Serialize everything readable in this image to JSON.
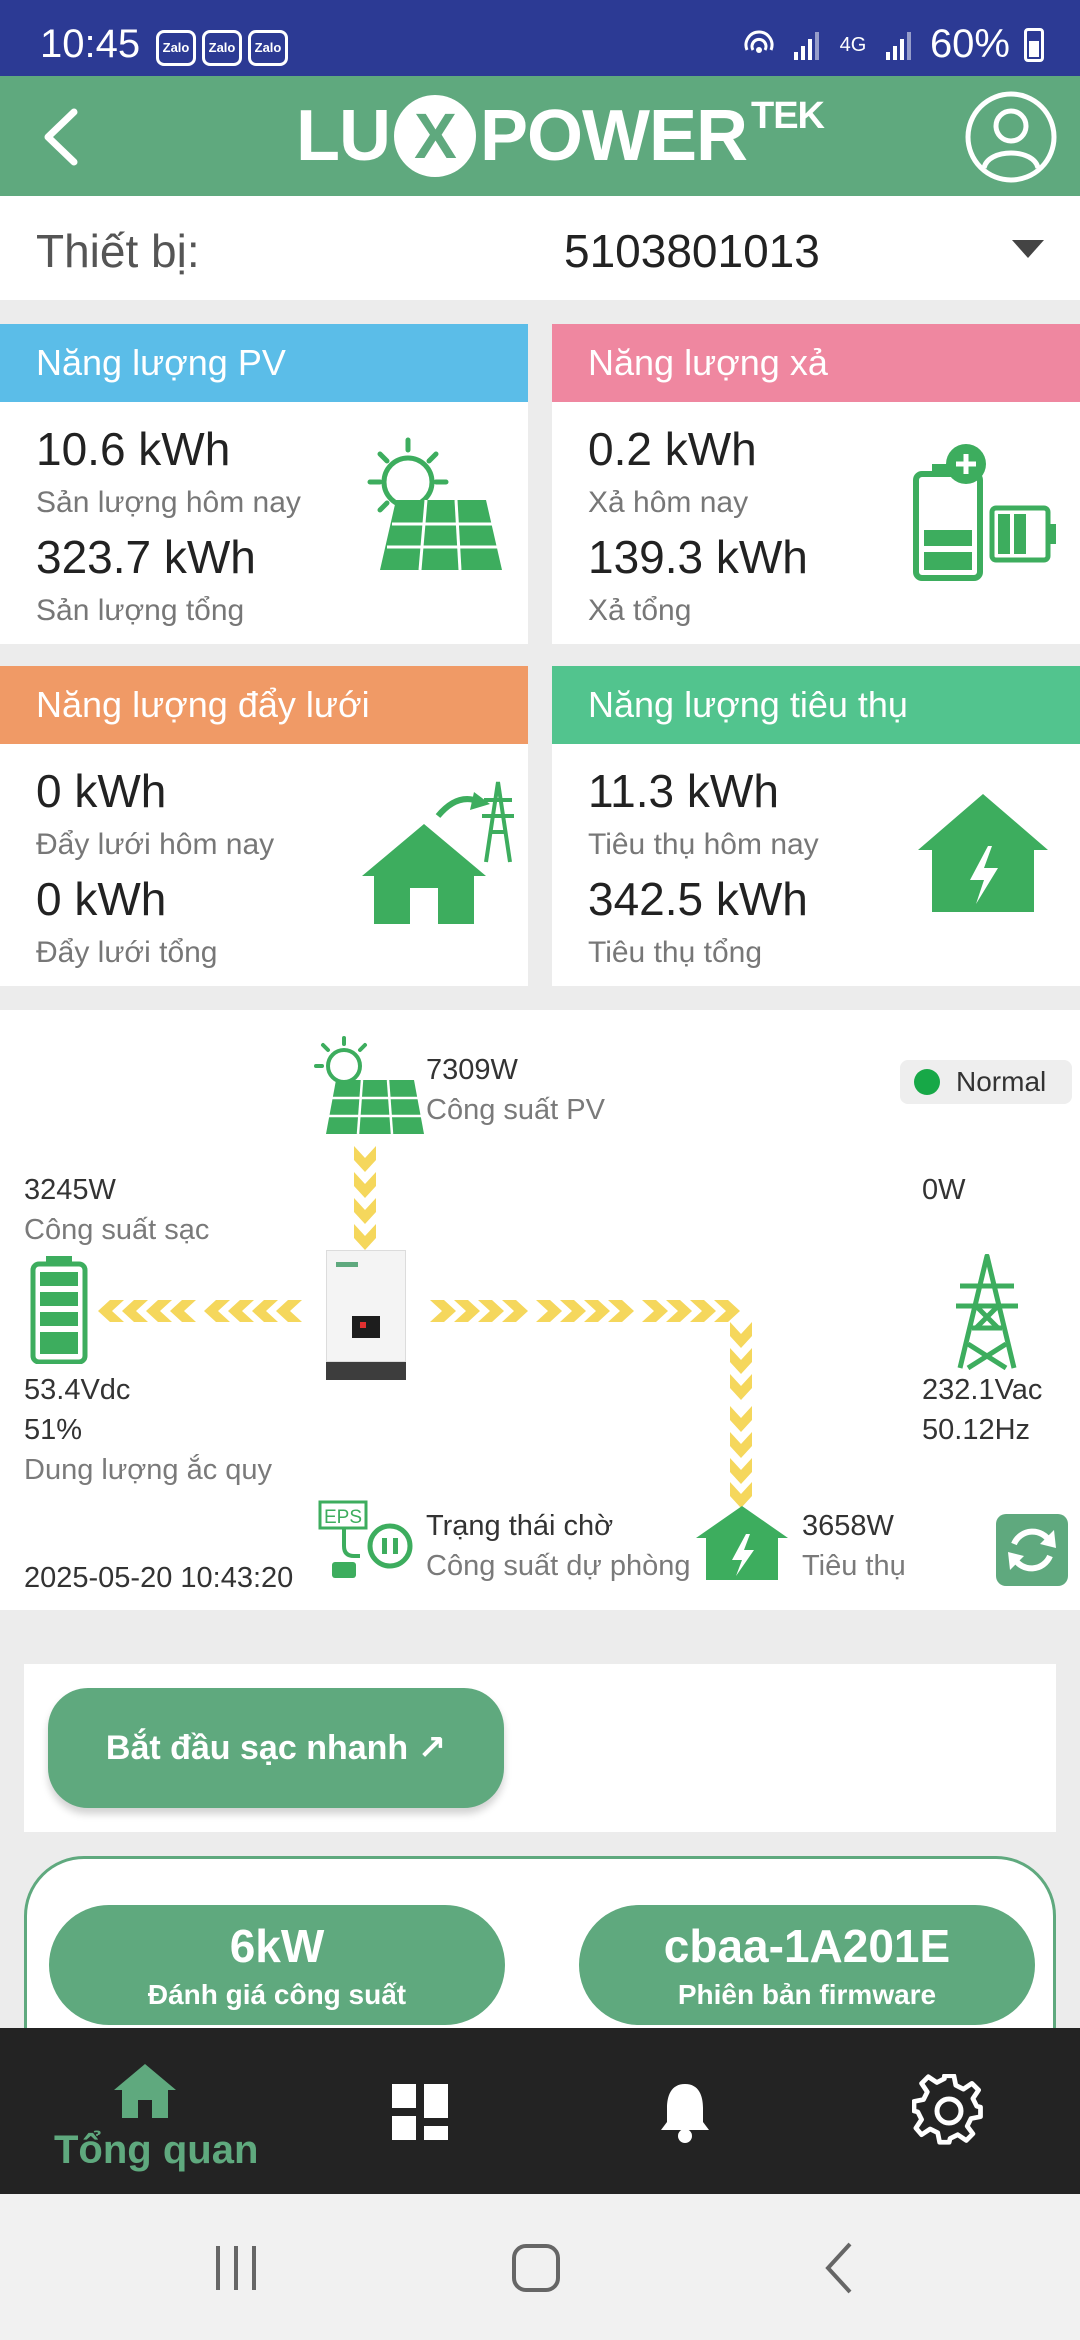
{
  "status_bar": {
    "time": "10:45",
    "notifications": [
      "Zalo",
      "Zalo",
      "Zalo"
    ],
    "network": "4G",
    "battery": "60%"
  },
  "app_bar": {
    "logo_left": "LU",
    "logo_x": "X",
    "logo_right": "POWER",
    "logo_sup": "TEK"
  },
  "device": {
    "label": "Thiết bị:",
    "value": "5103801013"
  },
  "cards": {
    "pv": {
      "title": "Năng lượng PV",
      "today_value": "10.6 kWh",
      "today_label": "Sản lượng hôm nay",
      "total_value": "323.7 kWh",
      "total_label": "Sản lượng tổng",
      "color": "#5bbde8"
    },
    "discharge": {
      "title": "Năng lượng xả",
      "today_value": "0.2 kWh",
      "today_label": "Xả hôm nay",
      "total_value": "139.3 kWh",
      "total_label": "Xả tổng",
      "color": "#ef87a0"
    },
    "grid": {
      "title": "Năng lượng đẩy lưới",
      "today_value": "0 kWh",
      "today_label": "Đẩy lưới hôm nay",
      "total_value": "0 kWh",
      "total_label": "Đẩy lưới tổng",
      "color": "#f09a66"
    },
    "consumption": {
      "title": "Năng lượng tiêu thụ",
      "today_value": "11.3 kWh",
      "today_label": "Tiêu thụ hôm nay",
      "total_value": "342.5 kWh",
      "total_label": "Tiêu thụ tổng",
      "color": "#52c48e"
    }
  },
  "flow": {
    "status": "Normal",
    "pv_power": "7309W",
    "pv_label": "Công suất PV",
    "charge_power": "3245W",
    "charge_label": "Công suất sạc",
    "battery_voltage": "53.4Vdc",
    "battery_soc": "51%",
    "battery_label": "Dung lượng ắc quy",
    "grid_power": "0W",
    "grid_voltage": "232.1Vac",
    "grid_freq": "50.12Hz",
    "eps_status": "Trạng thái chờ",
    "eps_label": "Công suất dự phòng",
    "eps_icon_text": "EPS",
    "load_power": "3658W",
    "load_label": "Tiêu thụ",
    "timestamp": "2025-05-20 10:43:20"
  },
  "fast_charge": {
    "label": "Bắt đầu sạc nhanh ↗"
  },
  "info": {
    "rating_value": "6kW",
    "rating_label": "Đánh giá công suất",
    "firmware_value": "cbaa-1A201E",
    "firmware_label": "Phiên bản firmware"
  },
  "bottom_nav": {
    "overview_label": "Tổng quan",
    "active_color": "#5fa97e"
  },
  "colors": {
    "brand": "#5fa97e",
    "status_bar": "#2c3a94"
  }
}
